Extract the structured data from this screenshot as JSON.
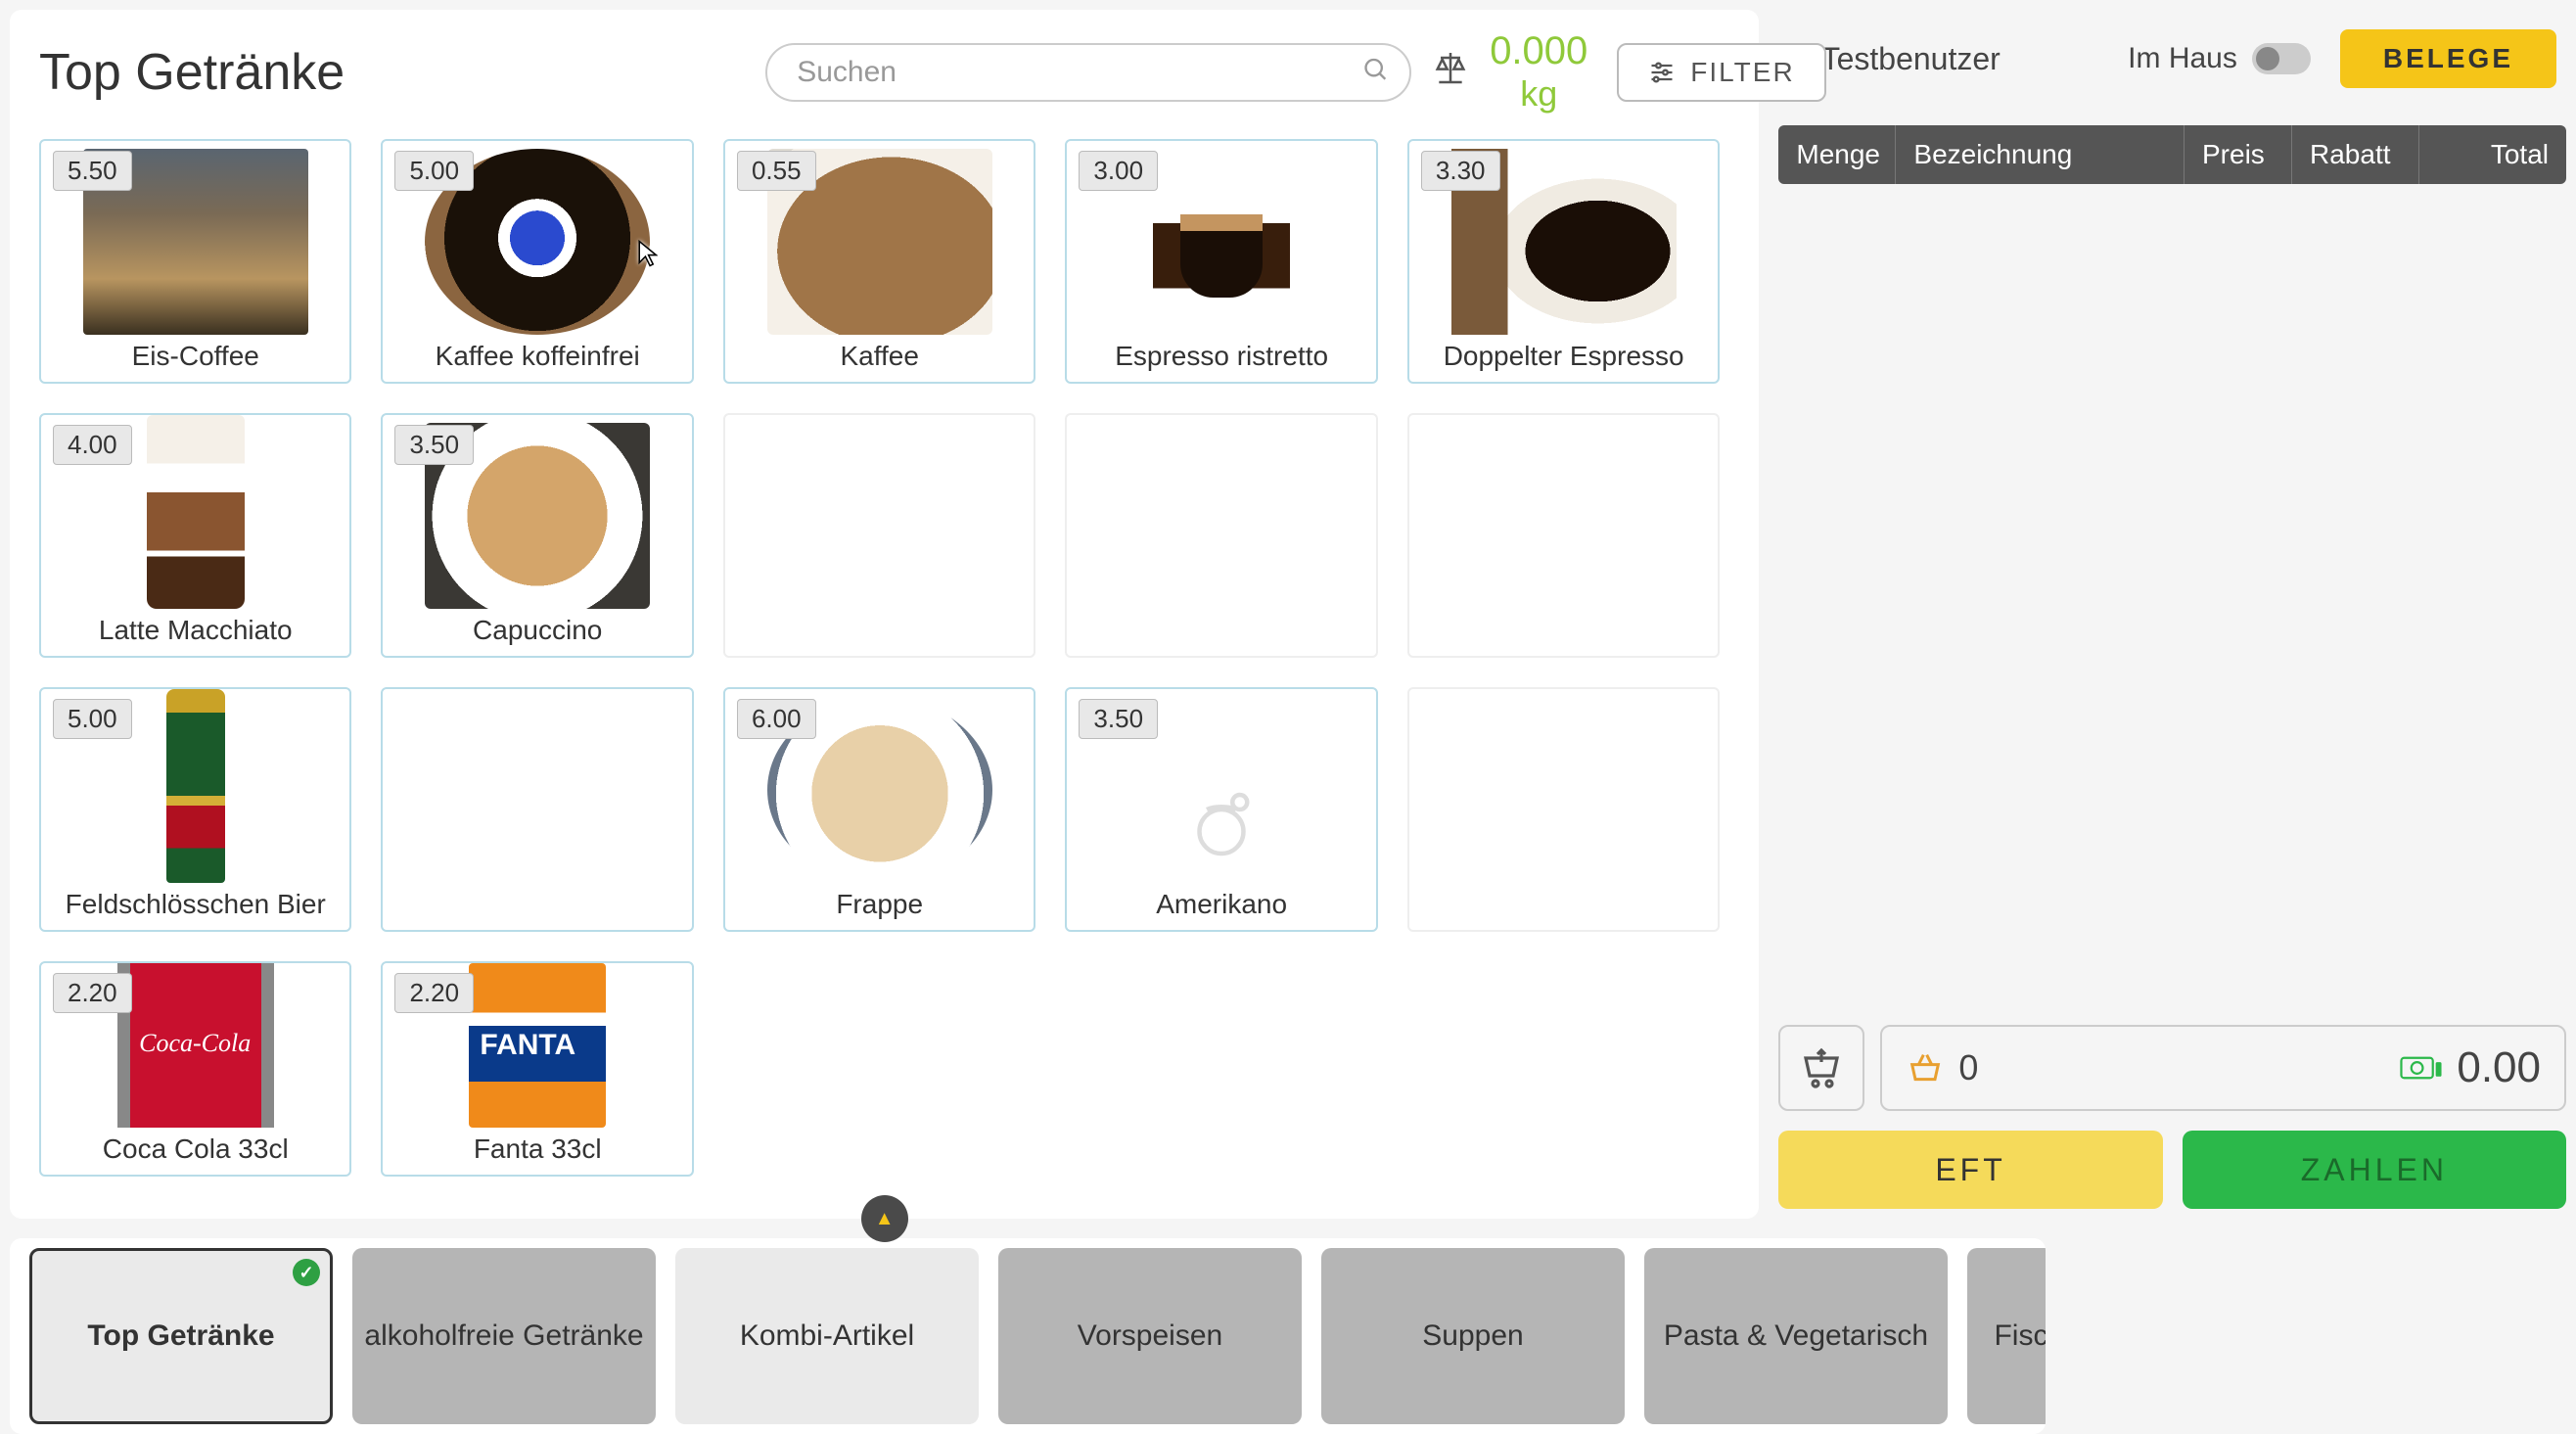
{
  "page_title": "Top Getränke",
  "search": {
    "placeholder": "Suchen"
  },
  "weight": {
    "value": "0.000",
    "unit": "kg"
  },
  "filter_label": "FILTER",
  "products": {
    "r0c0": {
      "price": "5.50",
      "name": "Eis-Coffee"
    },
    "r0c1": {
      "price": "5.00",
      "name": "Kaffee koffeinfrei"
    },
    "r0c2": {
      "price": "0.55",
      "name": "Kaffee"
    },
    "r0c3": {
      "price": "3.00",
      "name": "Espresso ristretto"
    },
    "r0c4": {
      "price": "3.30",
      "name": "Doppelter Espresso"
    },
    "r1c0": {
      "price": "4.00",
      "name": "Latte Macchiato"
    },
    "r1c1": {
      "price": "3.50",
      "name": "Capuccino"
    },
    "r2c0": {
      "price": "5.00",
      "name": "Feldschlösschen Bier"
    },
    "r2c2": {
      "price": "6.00",
      "name": "Frappe"
    },
    "r2c3": {
      "price": "3.50",
      "name": "Amerikano"
    },
    "r3c0": {
      "price": "2.20",
      "name": "Coca Cola 33cl"
    },
    "r3c1": {
      "price": "2.20",
      "name": "Fanta 33cl"
    }
  },
  "categories": {
    "c0": "Top Getränke",
    "c1": "alkoholfreie Getränke",
    "c2": "Kombi-Artikel",
    "c3": "Vorspeisen",
    "c4": "Suppen",
    "c5": "Pasta & Vegetarisch",
    "c6": "Fischge"
  },
  "right": {
    "user": "T. Testbenutzer",
    "im_haus": "Im Haus",
    "belege": "BELEGE",
    "headers": {
      "menge": "Menge",
      "bez": "Bezeichnung",
      "preis": "Preis",
      "rabatt": "Rabatt",
      "total": "Total"
    },
    "basket_count": "0",
    "sum_total": "0.00",
    "eft": "EFT",
    "zahlen": "ZAHLEN"
  }
}
